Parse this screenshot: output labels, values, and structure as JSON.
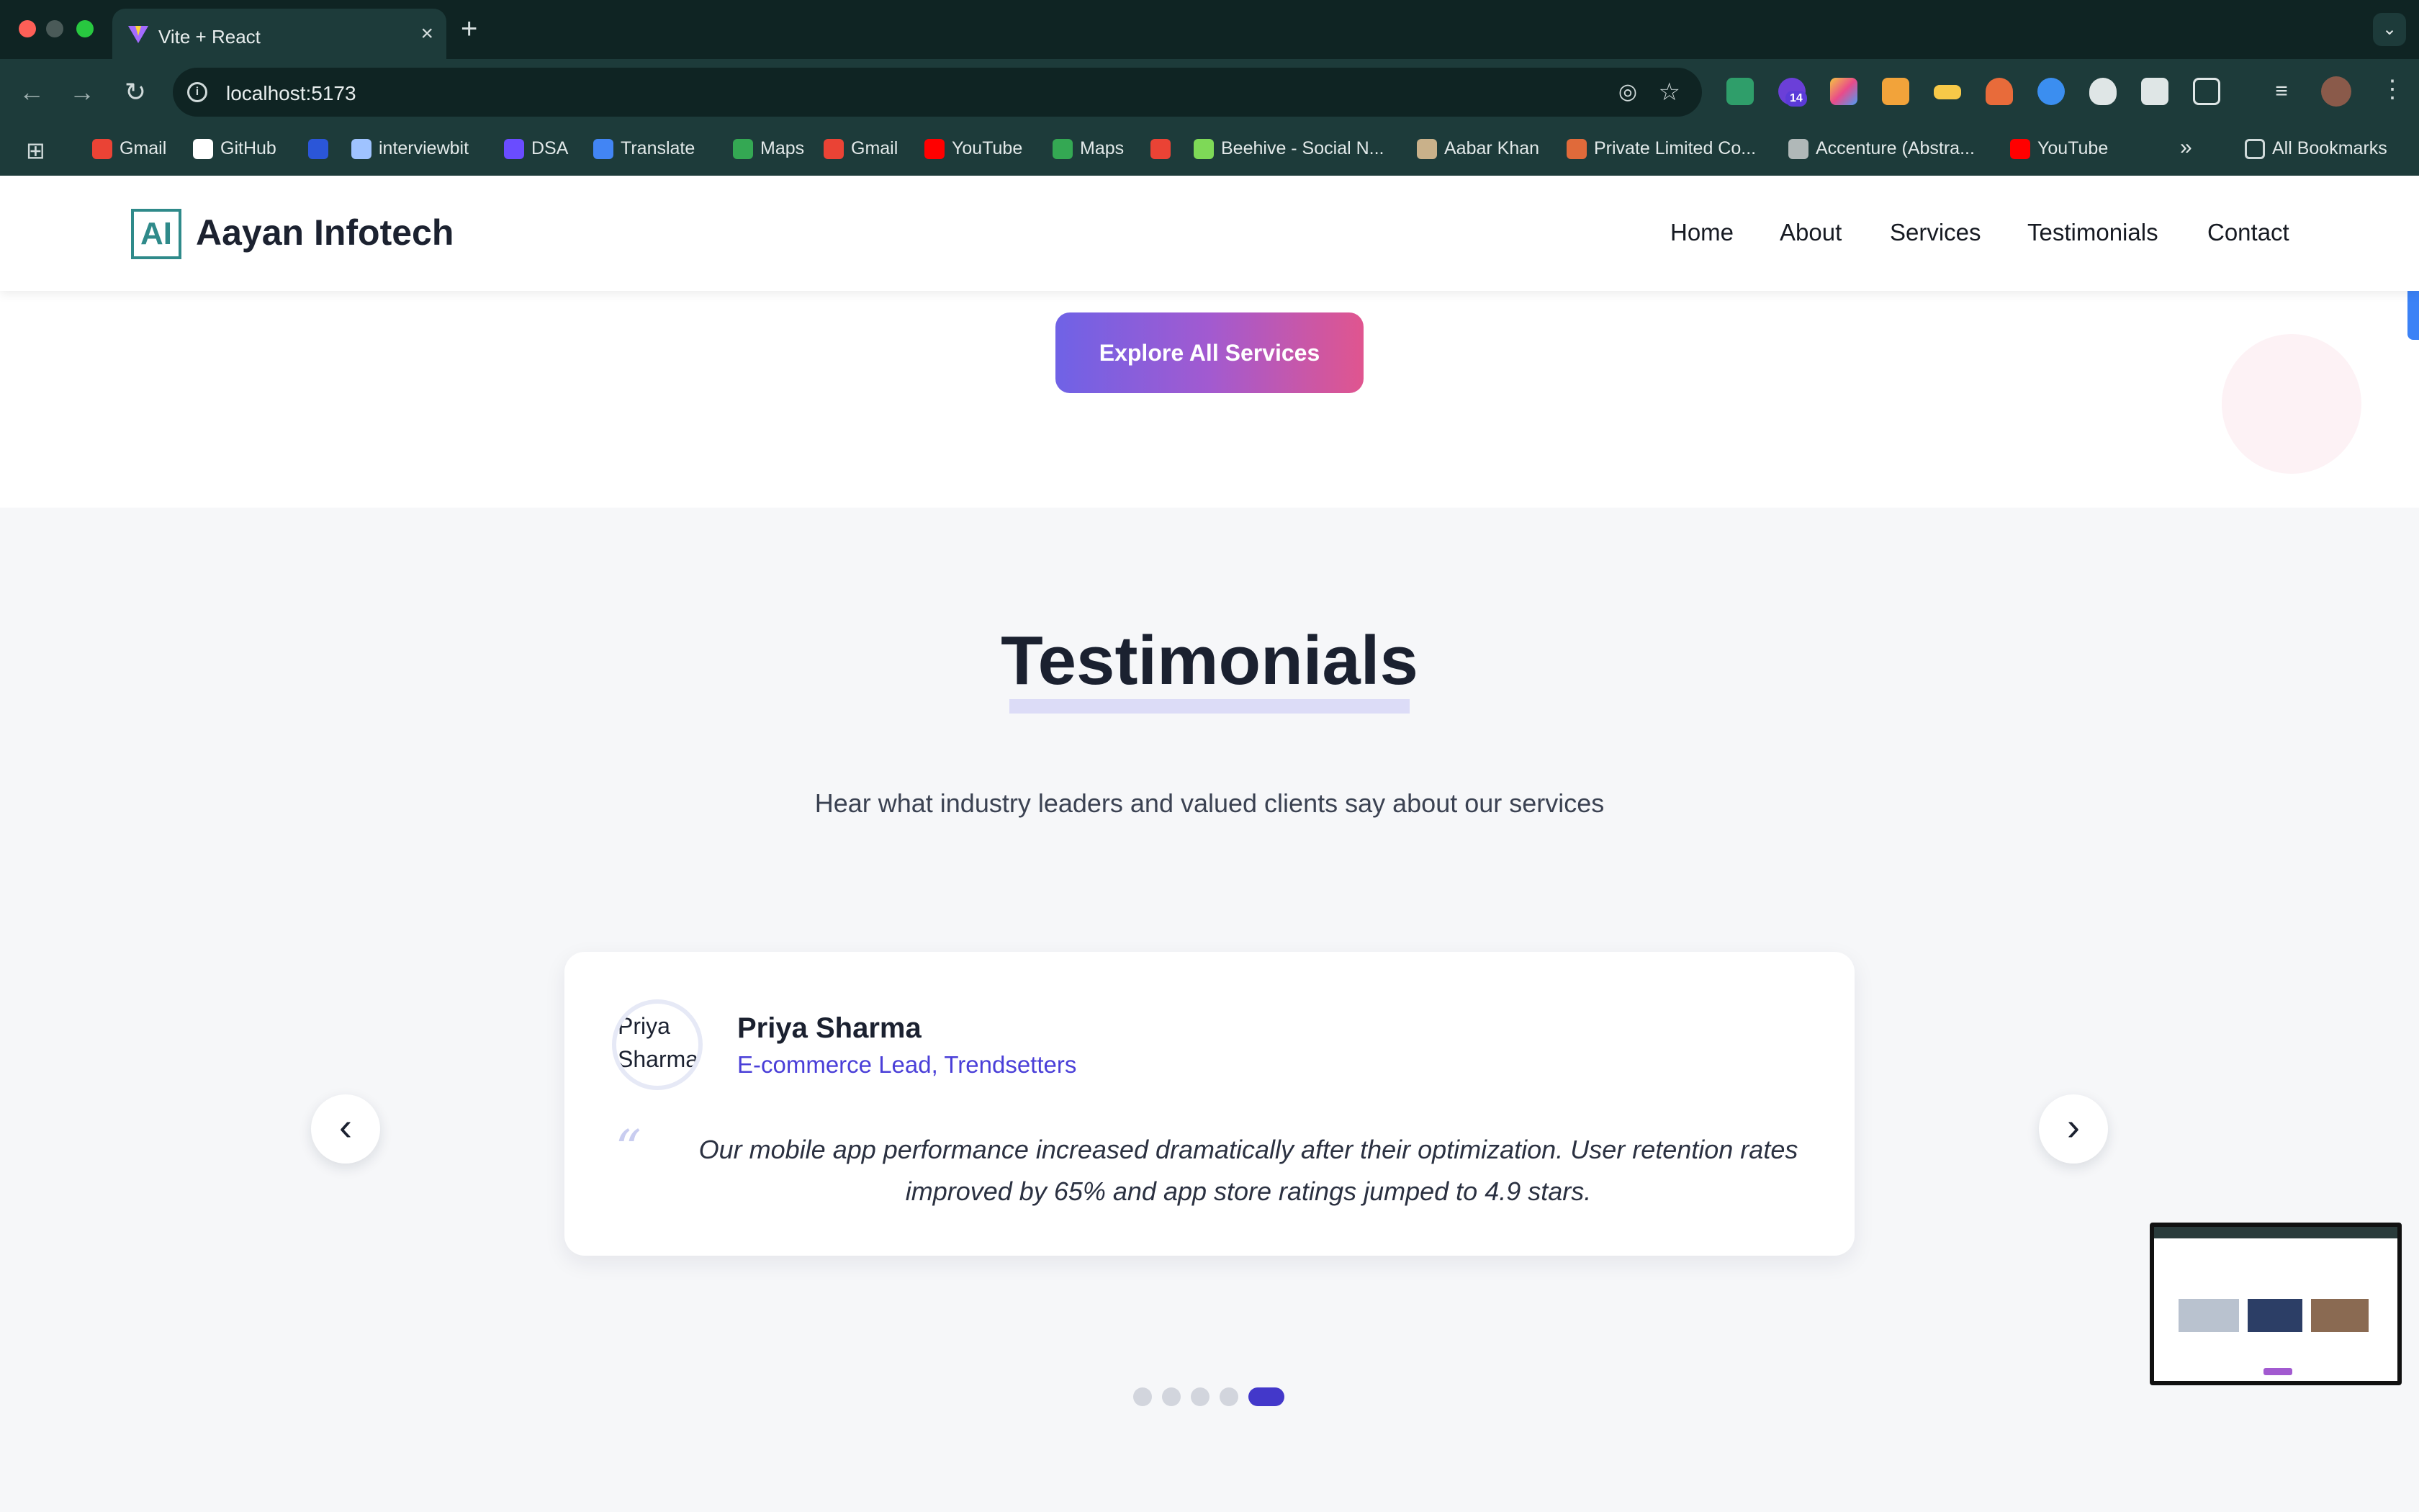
{
  "browser": {
    "tab_title": "Vite + React",
    "tab_close": "×",
    "new_tab": "+",
    "tab_menu": "⌄",
    "url": "localhost:5173",
    "ext_badge": "14",
    "bookmarks": [
      {
        "label": "Gmail",
        "color": "#ea4335"
      },
      {
        "label": "GitHub",
        "color": "#ffffff"
      },
      {
        "label": "",
        "color": "#2b56d8"
      },
      {
        "label": "interviewbit",
        "color": "#9fc3ff"
      },
      {
        "label": "DSA",
        "color": "#6a4cff"
      },
      {
        "label": "Translate",
        "color": "#4285f4"
      },
      {
        "label": "Maps",
        "color": "#34a853"
      },
      {
        "label": "Gmail",
        "color": "#ea4335"
      },
      {
        "label": "YouTube",
        "color": "#ff0000"
      },
      {
        "label": "Maps",
        "color": "#34a853"
      },
      {
        "label": "",
        "color": "#ea4335"
      },
      {
        "label": "Beehive - Social N...",
        "color": "#7ed957"
      },
      {
        "label": "Aabar Khan",
        "color": "#c9b18a"
      },
      {
        "label": "Private Limited Co...",
        "color": "#e06a3a"
      },
      {
        "label": "Accenture (Abstra...",
        "color": "#b0b8b8"
      },
      {
        "label": "YouTube",
        "color": "#ff0000"
      }
    ],
    "bookmarks_overflow": "»",
    "all_bookmarks": "All Bookmarks"
  },
  "site": {
    "brand_mark": "AI",
    "brand_name": "Aayan Infotech",
    "nav": [
      "Home",
      "About",
      "Services",
      "Testimonials",
      "Contact"
    ],
    "cta_label": "Explore All Services"
  },
  "testimonials": {
    "title": "Testimonials",
    "subtitle": "Hear what industry leaders and valued clients say about our services",
    "card": {
      "avatar_alt": "Priya Sharma",
      "name": "Priya Sharma",
      "role": "E-commerce Lead, Trendsetters",
      "quote_mark": "“",
      "text": "Our mobile app performance increased dramatically after their optimization. User retention rates improved by 65% and app store ratings jumped to 4.9 stars."
    },
    "prev_icon": "‹",
    "next_icon": "›",
    "total_slides": 5,
    "active_slide": 5
  },
  "colors": {
    "accent": "#4338ca",
    "cta_gradient_start": "#6f62e6",
    "cta_gradient_end": "#e0558f",
    "chrome_dark": "#0f2423"
  }
}
